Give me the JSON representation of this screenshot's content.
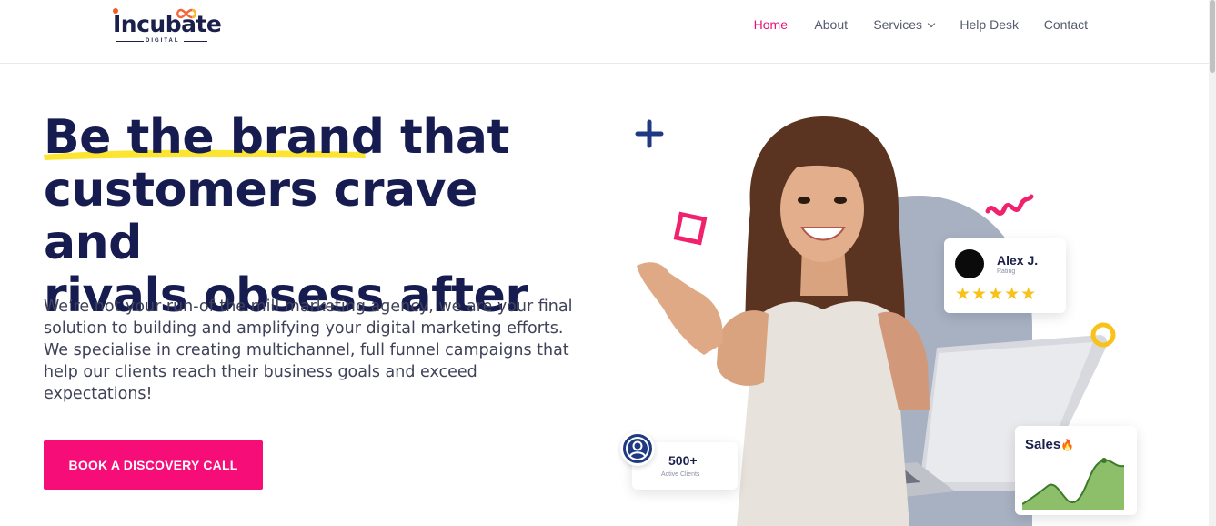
{
  "brand": {
    "name": "Incubate",
    "tagline": "DIGITAL"
  },
  "nav": {
    "items": [
      {
        "label": "Home",
        "active": true
      },
      {
        "label": "About",
        "active": false
      },
      {
        "label": "Services",
        "active": false
      },
      {
        "label": "Help Desk",
        "active": false
      },
      {
        "label": "Contact",
        "active": false
      }
    ]
  },
  "hero": {
    "headline_highlight": "Be the brand",
    "headline_rest_line1": " that",
    "headline_line2": "customers crave and",
    "headline_line3": "rivals obsess after",
    "description": "We’re not your run-of the mill marketing agency, we are your final solution to building and amplifying your digital marketing efforts. We specialise in creating multichannel, full funnel campaigns that help our clients reach their business goals and exceed expectations!",
    "cta_label": "BOOK A DISCOVERY CALL"
  },
  "cards": {
    "review": {
      "name": "Alex J.",
      "subtitle": "Rating",
      "stars": 5,
      "stars_text": "★★★★★"
    },
    "clients": {
      "value": "500+",
      "label": "Active Clients"
    },
    "sales": {
      "title": "Sales",
      "icon": "fire-emoji"
    }
  },
  "colors": {
    "primary_navy": "#161c4f",
    "accent_pink": "#f70d78",
    "active_nav": "#e6117a",
    "highlight_yellow": "#fbe531",
    "chart_green": "#8dbf6a",
    "star_yellow": "#f8c21a",
    "blob_gray": "#a7b1c2"
  }
}
